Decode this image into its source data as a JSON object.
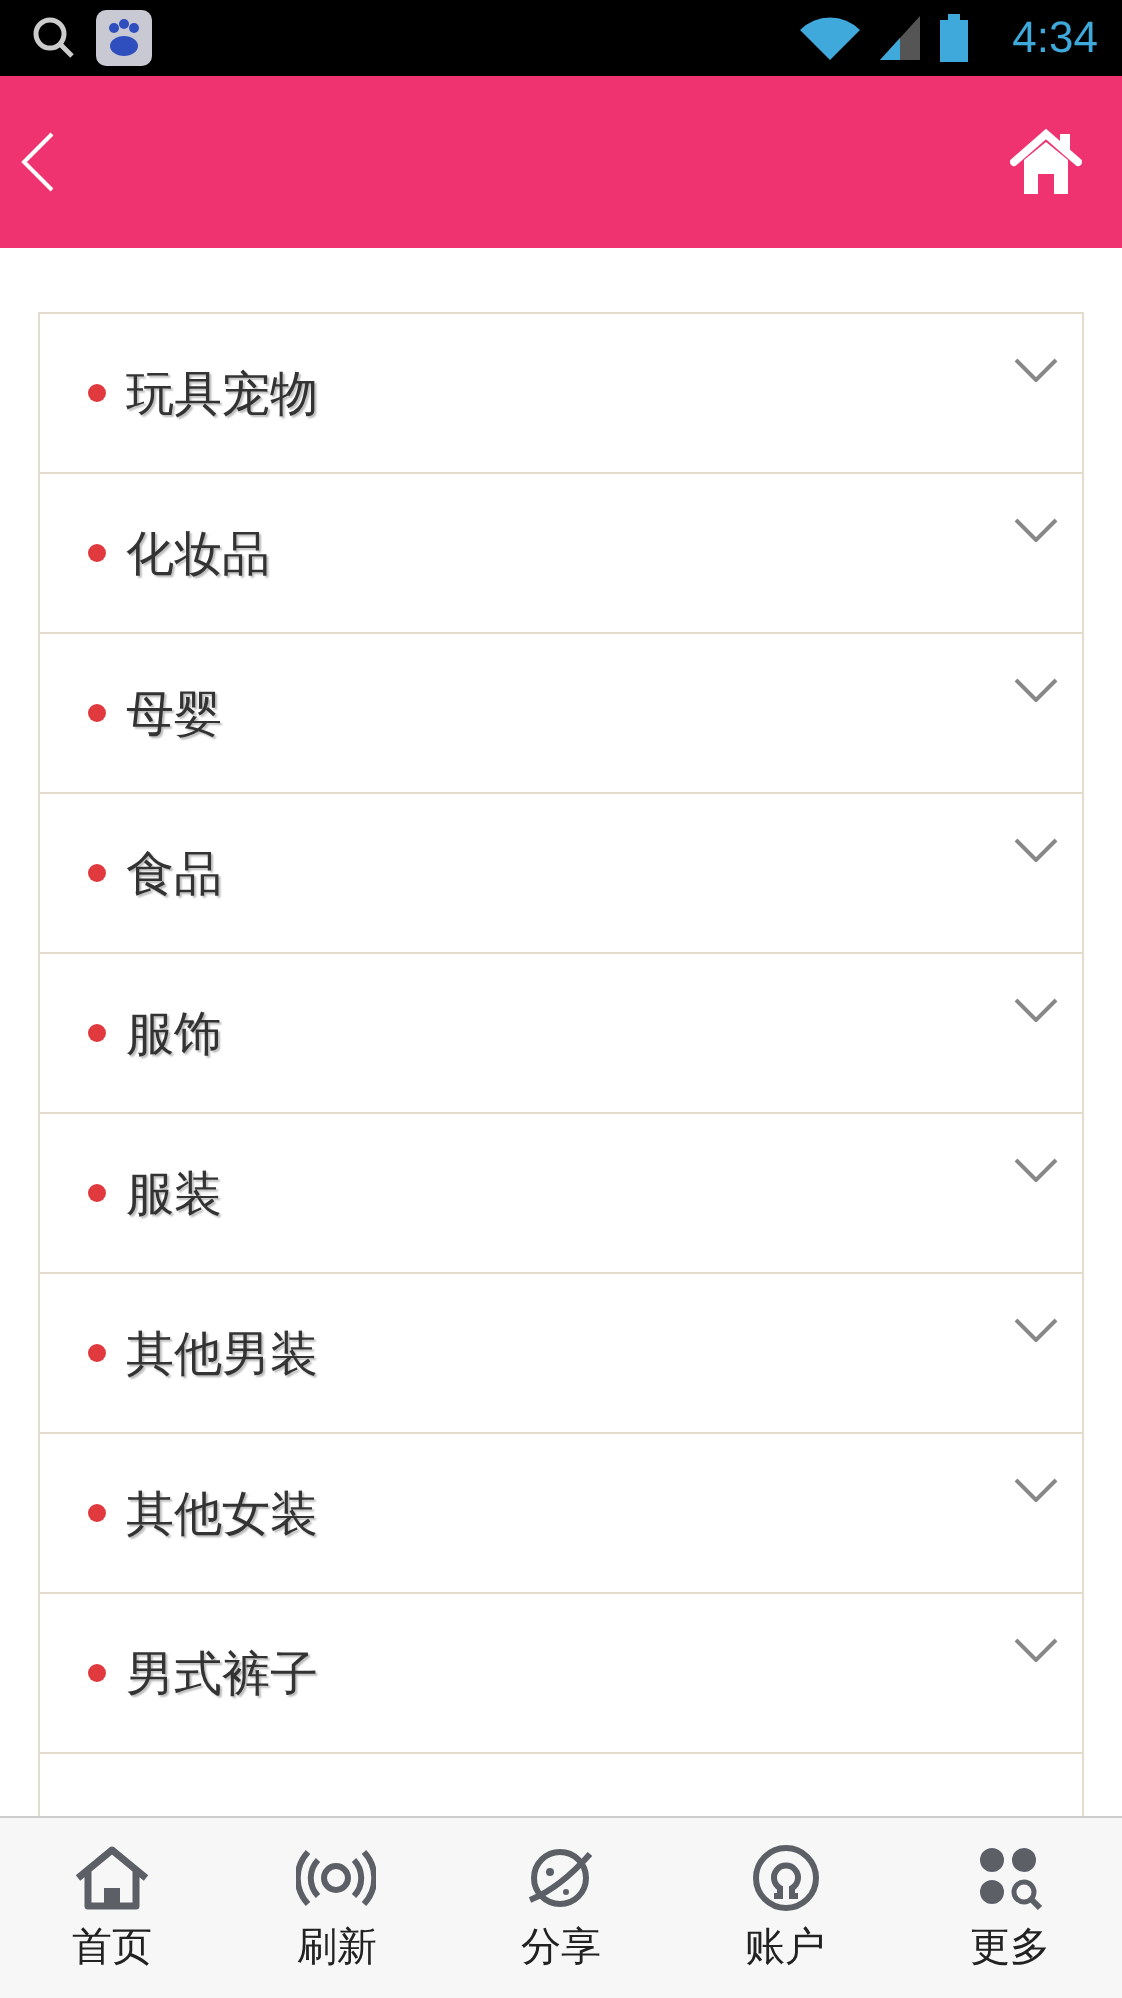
{
  "status_bar": {
    "time": "4:34"
  },
  "categories": [
    {
      "label": "玩具宠物"
    },
    {
      "label": "化妆品"
    },
    {
      "label": "母婴"
    },
    {
      "label": "食品"
    },
    {
      "label": "服饰"
    },
    {
      "label": "服装"
    },
    {
      "label": "其他男装"
    },
    {
      "label": "其他女装"
    },
    {
      "label": "男式裤子"
    }
  ],
  "tab_bar": [
    {
      "label": "首页",
      "kind": "home"
    },
    {
      "label": "刷新",
      "kind": "refresh"
    },
    {
      "label": "分享",
      "kind": "share"
    },
    {
      "label": "账户",
      "kind": "account"
    },
    {
      "label": "更多",
      "kind": "more"
    }
  ]
}
